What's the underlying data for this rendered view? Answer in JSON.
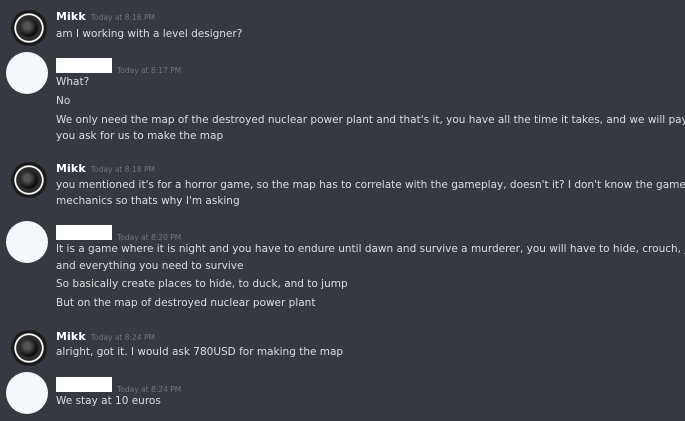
{
  "messages": [
    {
      "author": "Mikk",
      "timestamp": "Today at 8:16 PM",
      "lines": [
        "am I working with a level designer?"
      ]
    },
    {
      "author": "",
      "timestamp": "Today at 8:17 PM",
      "lines": [
        "What?",
        "No",
        "We only need the map of the destroyed nuclear power plant and that's it, you have all the time it takes, and we will pay you,",
        "you ask for us to make the map"
      ]
    },
    {
      "author": "Mikk",
      "timestamp": "Today at 8:18 PM",
      "lines": [
        "you mentioned it's for a horror game, so the map has to correlate with the gameplay, doesn't it? I don't know the game's",
        "mechanics so thats why I'm asking"
      ]
    },
    {
      "author": "",
      "timestamp": "Today at 8:20 PM",
      "lines": [
        "It is a game where it is night and you have to endure until dawn and survive a murderer, you will have to hide, crouch, jump,",
        "and everything you need to survive",
        "So basically create places to hide, to duck, and to jump",
        "But on the map of destroyed nuclear power plant"
      ]
    },
    {
      "author": "Mikk",
      "timestamp": "Today at 8:24 PM",
      "lines": [
        "alright, got it. I would ask 780USD for making the map"
      ]
    },
    {
      "author": "",
      "timestamp": "Today at 8:24 PM",
      "lines": [
        "We stay at 10 euros"
      ]
    }
  ]
}
